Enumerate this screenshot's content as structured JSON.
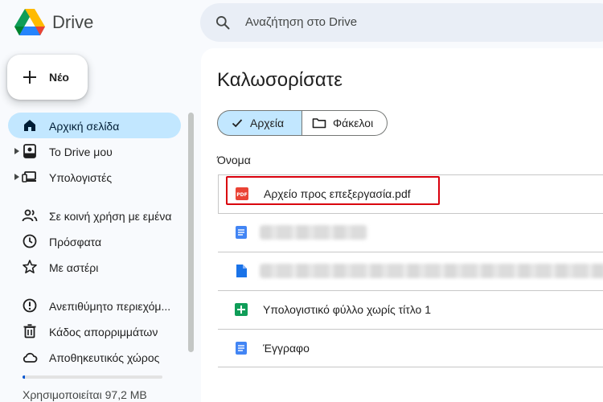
{
  "header": {
    "app_name": "Drive",
    "search_placeholder": "Αναζήτηση στο Drive"
  },
  "new_button": {
    "label": "Νέο"
  },
  "sidebar": {
    "items": [
      {
        "label": "Αρχική σελίδα",
        "icon": "home-icon",
        "active": true
      },
      {
        "label": "Το Drive μου",
        "icon": "my-drive-icon",
        "expandable": true
      },
      {
        "label": "Υπολογιστές",
        "icon": "computers-icon",
        "expandable": true
      },
      {
        "label": "Σε κοινή χρήση με εμένα",
        "icon": "shared-icon"
      },
      {
        "label": "Πρόσφατα",
        "icon": "clock-icon"
      },
      {
        "label": "Με αστέρι",
        "icon": "star-icon"
      },
      {
        "label": "Ανεπιθύμητο περιεχόμ...",
        "icon": "spam-icon"
      },
      {
        "label": "Κάδος απορριμμάτων",
        "icon": "trash-icon"
      },
      {
        "label": "Αποθηκευτικός χώρος",
        "icon": "cloud-icon"
      }
    ],
    "storage_text": "Χρησιμοποιείται 97,2 MB",
    "storage_fraction": 0.02
  },
  "main": {
    "title": "Καλωσορίσατε",
    "filter_files": "Αρχεία",
    "filter_folders": "Φάκελοι",
    "column_name": "Όνομα",
    "files": [
      {
        "name": "Αρχείο προς επεξεργασία.pdf",
        "type": "pdf",
        "highlighted": true
      },
      {
        "name": "",
        "type": "docs",
        "obscured": true
      },
      {
        "name": "",
        "type": "file",
        "obscured": true
      },
      {
        "name": "Υπολογιστικό φύλλο χωρίς τίτλο 1",
        "type": "sheets"
      },
      {
        "name": "Έγγραφο",
        "type": "docs"
      }
    ]
  },
  "colors": {
    "accent": "#0b57d0",
    "active_bg": "#c2e7ff",
    "highlight": "#d9000d",
    "pdf": "#ea4335",
    "docs": "#4285f4",
    "sheets": "#0f9d58"
  }
}
